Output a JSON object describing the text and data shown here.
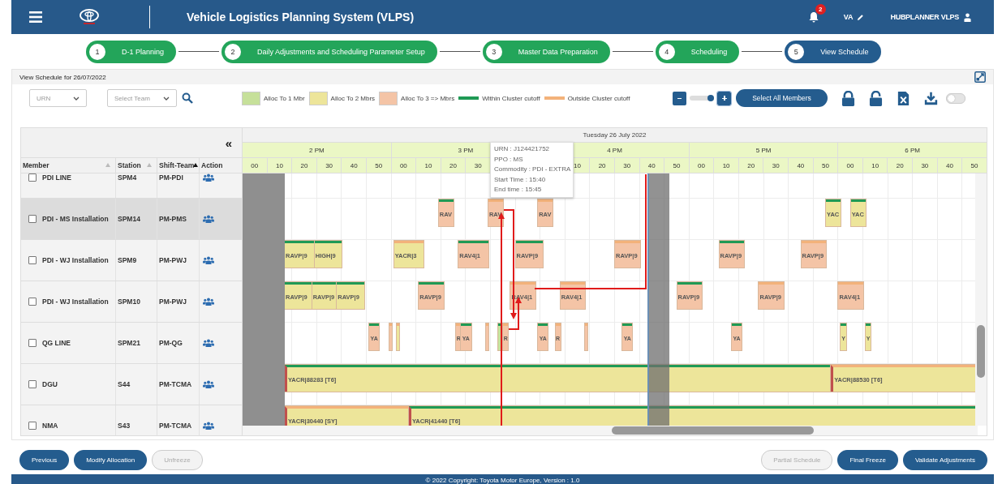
{
  "header": {
    "title": "Vehicle Logistics Planning System (VLPS)",
    "notifications": "2",
    "user_initials": "VA",
    "user_name": "HUBPLANNER VLPS"
  },
  "steps": [
    {
      "number": "1",
      "label": "D-1 Planning",
      "selected": false
    },
    {
      "number": "2",
      "label": "Daily Adjustments and Scheduling Parameter Setup",
      "selected": false
    },
    {
      "number": "3",
      "label": "Master Data Preparation",
      "selected": false
    },
    {
      "number": "4",
      "label": "Scheduling",
      "selected": false
    },
    {
      "number": "5",
      "label": "View Schedule",
      "selected": true
    }
  ],
  "panel": {
    "title": "View Schedule for 26/07/2022"
  },
  "filters": [
    {
      "placeholder": "URN"
    },
    {
      "placeholder": "Select Team"
    }
  ],
  "legend": [
    {
      "kind": "box",
      "label": "Alloc To 1 Mbr",
      "color": "#c6e09a"
    },
    {
      "kind": "box",
      "label": "Alloc To 2 Mbrs",
      "color": "#ede59a"
    },
    {
      "kind": "box",
      "label": "Alloc To 3 => Mbrs",
      "color": "#f4c4a6"
    },
    {
      "kind": "line",
      "label": "Within Cluster cutoff",
      "color": "#1f9a55"
    },
    {
      "kind": "line",
      "label": "Outside Cluster cutoff",
      "color": "#f3b27a"
    }
  ],
  "zoom": {
    "level": 0.85
  },
  "select_all": "Select All Members",
  "toggle": {
    "on": false
  },
  "gantt": {
    "collapse": "«",
    "date": "Tuesday 26 July 2022",
    "columns": [
      {
        "label": "Member",
        "sorted": false
      },
      {
        "label": "Station",
        "sorted": false
      },
      {
        "label": "Shift-Team",
        "sorted": true
      },
      {
        "label": "Action"
      }
    ],
    "hours": [
      {
        "label": "2 PM",
        "ticks": [
          "00",
          "10",
          "20",
          "30",
          "40",
          "50"
        ]
      },
      {
        "label": "3 PM",
        "ticks": [
          "00",
          "10",
          "20",
          "30"
        ]
      },
      {
        "label": "4 PM",
        "ticks": [
          "10",
          "20",
          "30",
          "40",
          "50"
        ]
      },
      {
        "label": "5 PM",
        "ticks": [
          "00",
          "10",
          "20",
          "30",
          "40",
          "50"
        ]
      },
      {
        "label": "6 PM",
        "ticks": [
          "00",
          "10",
          "20",
          "30",
          "40",
          "50"
        ]
      }
    ],
    "rows": [
      {
        "member": "PDI LINE",
        "station": "SPM4",
        "team": "PM-PDI",
        "checked": false,
        "selected": false,
        "bars": []
      },
      {
        "member": "PDI - MS Installation",
        "station": "SPM14",
        "team": "PM-PMS",
        "checked": false,
        "selected": true,
        "bars": [
          {
            "label": "RAV",
            "color": "#f4c4a6",
            "within_cutoff": true
          },
          {
            "label": "RAV",
            "color": "#f4c4a6",
            "within_cutoff": false
          },
          {
            "label": "RAV",
            "color": "#f4c4a6",
            "within_cutoff": false
          },
          {
            "label": "YAC",
            "color": "#ede59a",
            "within_cutoff": true
          },
          {
            "label": "YAC",
            "color": "#ede59a",
            "within_cutoff": true
          }
        ]
      },
      {
        "member": "PDI - WJ Installation",
        "station": "SPM9",
        "team": "PM-PWJ",
        "checked": false,
        "selected": false,
        "bars": [
          {
            "label": "RAVP|9",
            "color": "#ede59a",
            "within_cutoff": true
          },
          {
            "label": "HIGH|9",
            "color": "#ede59a",
            "within_cutoff": true
          },
          {
            "label": "YACR|3",
            "color": "#ede59a",
            "within_cutoff": false
          },
          {
            "label": "RAV4|1",
            "color": "#f4c4a6",
            "within_cutoff": true
          },
          {
            "label": "RAVP|9",
            "color": "#f4c4a6",
            "within_cutoff": true
          },
          {
            "label": "RAVP|9",
            "color": "#f4c4a6",
            "within_cutoff": false
          },
          {
            "label": "RAVP|9",
            "color": "#f4c4a6",
            "within_cutoff": true
          },
          {
            "label": "RAVP|9",
            "color": "#f4c4a6",
            "within_cutoff": false
          }
        ]
      },
      {
        "member": "PDI - WJ Installation",
        "station": "SPM10",
        "team": "PM-PWJ",
        "checked": false,
        "selected": false,
        "bars": [
          {
            "label": "RAVP|9",
            "color": "#ede59a",
            "within_cutoff": true
          },
          {
            "label": "RAVP|9",
            "color": "#ede59a",
            "within_cutoff": true
          },
          {
            "label": "RAVP|9",
            "color": "#ede59a",
            "within_cutoff": true
          },
          {
            "label": "RAVP|9",
            "color": "#f4c4a6",
            "within_cutoff": true
          },
          {
            "label": "RAV4|1",
            "color": "#f4c4a6",
            "within_cutoff": false
          },
          {
            "label": "RAV4|1",
            "color": "#f4c4a6",
            "within_cutoff": false
          },
          {
            "label": "RAVP|9",
            "color": "#f4c4a6",
            "within_cutoff": true
          },
          {
            "label": "RAVP|9",
            "color": "#f4c4a6",
            "within_cutoff": false
          },
          {
            "label": "RAV4|1",
            "color": "#f4c4a6",
            "within_cutoff": false
          }
        ]
      },
      {
        "member": "QG LINE",
        "station": "SPM21",
        "team": "PM-QG",
        "checked": false,
        "selected": false,
        "bars": [
          {
            "label": "YA",
            "color": "#f4c4a6",
            "within_cutoff": true
          },
          {
            "color": "#f4c4a6",
            "within_cutoff": false
          },
          {
            "color": "#ede59a",
            "within_cutoff": false
          },
          {
            "label": "R",
            "color": "#f4c4a6",
            "within_cutoff": false
          },
          {
            "label": "YA",
            "color": "#f4c4a6",
            "within_cutoff": true
          },
          {
            "color": "#f4c4a6",
            "within_cutoff": false
          },
          {
            "color": "#c6e09a",
            "within_cutoff": true
          },
          {
            "label": "R",
            "color": "#f4c4a6",
            "within_cutoff": false
          },
          {
            "label": "YA",
            "color": "#f4c4a6",
            "within_cutoff": true
          },
          {
            "label": "R",
            "color": "#f4c4a6",
            "within_cutoff": false
          },
          {
            "color": "#f4c4a6",
            "within_cutoff": false
          },
          {
            "label": "YA",
            "color": "#f4c4a6",
            "within_cutoff": true
          },
          {
            "label": "YA",
            "color": "#f4c4a6",
            "within_cutoff": true
          },
          {
            "label": "Y",
            "color": "#ede59a",
            "within_cutoff": true
          },
          {
            "label": "Y",
            "color": "#ede59a",
            "within_cutoff": true
          }
        ]
      },
      {
        "member": "DGU",
        "station": "S44",
        "team": "PM-TCMA",
        "checked": false,
        "selected": false,
        "bars": [
          {
            "label": "YACR|88283 [T6]",
            "color": "#ede59a",
            "within_cutoff": true,
            "start_mark": true
          },
          {
            "label": "YACR|88530 [T6]",
            "color": "#ede59a",
            "within_cutoff": false,
            "start_mark": true
          }
        ]
      },
      {
        "member": "NMA",
        "station": "S43",
        "team": "PM-TCMA",
        "checked": false,
        "selected": false,
        "bars": [
          {
            "label": "YACR|30440 [SY]",
            "color": "#ede59a",
            "within_cutoff": false,
            "start_mark": true
          },
          {
            "label": "YACR|41440 [T6]",
            "color": "#ede59a",
            "within_cutoff": true,
            "start_mark": true
          }
        ]
      }
    ]
  },
  "tooltip": {
    "lines": [
      "URN : J124421752",
      "PPO : MS",
      "Commodity : PDI - EXTRA",
      "Start Time : 15:40",
      "End time : 15:45"
    ]
  },
  "buttons_left": [
    {
      "label": "Previous",
      "disabled": false
    },
    {
      "label": "Modify Allocation",
      "disabled": false
    },
    {
      "label": "Unfreeze",
      "disabled": true
    }
  ],
  "buttons_right": [
    {
      "label": "Partial Schedule",
      "disabled": true
    },
    {
      "label": "Final Freeze",
      "disabled": false
    },
    {
      "label": "Validate Adjustments",
      "disabled": false
    }
  ],
  "footer": "© 2022 Copyright: Toyota Motor Europe, Version : 1.0"
}
